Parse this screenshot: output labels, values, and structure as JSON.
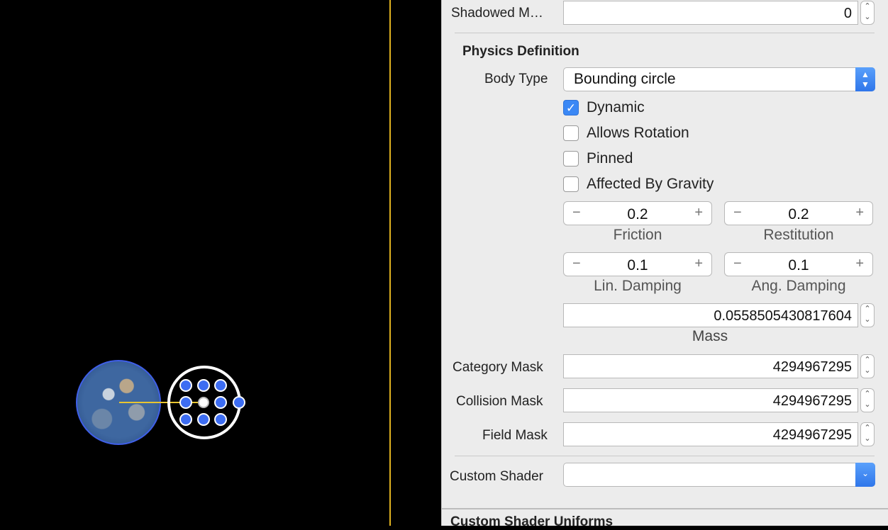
{
  "inspector": {
    "shadowed_mask": {
      "label": "Shadowed M…",
      "value": "0"
    },
    "physics": {
      "title": "Physics Definition",
      "body_type_label": "Body Type",
      "body_type_value": "Bounding circle",
      "checkboxes": [
        {
          "label": "Dynamic",
          "checked": true
        },
        {
          "label": "Allows Rotation",
          "checked": false
        },
        {
          "label": "Pinned",
          "checked": false
        },
        {
          "label": "Affected By Gravity",
          "checked": false
        }
      ],
      "friction": {
        "value": "0.2",
        "label": "Friction"
      },
      "restitution": {
        "value": "0.2",
        "label": "Restitution"
      },
      "lin_damping": {
        "value": "0.1",
        "label": "Lin. Damping"
      },
      "ang_damping": {
        "value": "0.1",
        "label": "Ang. Damping"
      },
      "mass": {
        "value": "0.0558505430817604",
        "label": "Mass"
      },
      "category_mask": {
        "label": "Category Mask",
        "value": "4294967295"
      },
      "collision_mask": {
        "label": "Collision Mask",
        "value": "4294967295"
      },
      "field_mask": {
        "label": "Field Mask",
        "value": "4294967295"
      }
    },
    "custom_shader": {
      "label": "Custom Shader",
      "value": ""
    },
    "uniforms_title": "Custom Shader Uniforms"
  },
  "colors": {
    "accent": "#3b88f5",
    "scene_edge": "#e0b321",
    "selection": "#3d6df2"
  }
}
